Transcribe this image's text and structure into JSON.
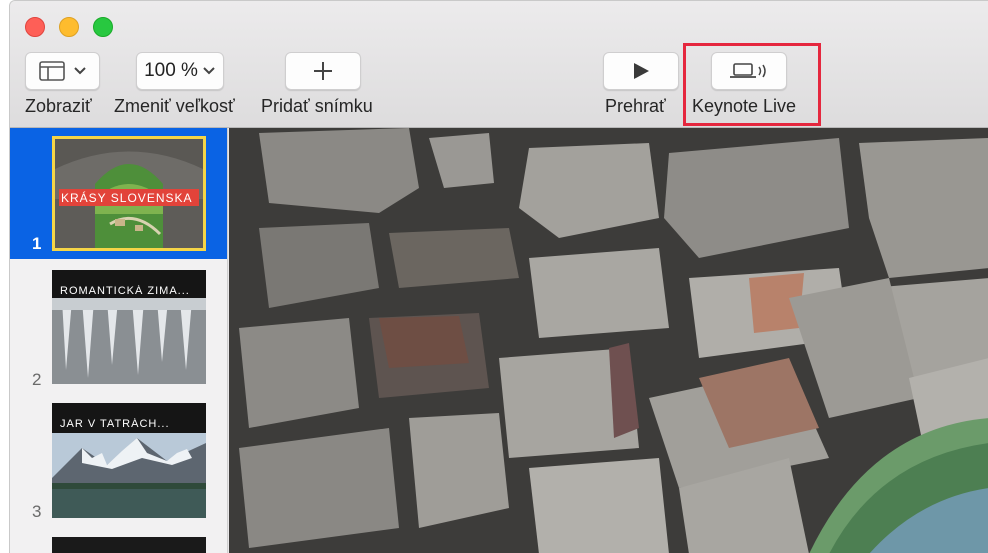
{
  "toolbar": {
    "view_label": "Zobraziť",
    "zoom_value": "100 %",
    "zoom_label": "Zmeniť veľkosť",
    "add_slide_label": "Pridať snímku",
    "play_label": "Prehrať",
    "keynote_live_label": "Keynote Live"
  },
  "slides": [
    {
      "number": "1",
      "title": "KRÁSY SLOVENSKA"
    },
    {
      "number": "2",
      "title": "ROMANTICKÁ ZIMA..."
    },
    {
      "number": "3",
      "title": "JAR V TATRÁCH..."
    }
  ],
  "colors": {
    "selection": "#0a63e4",
    "highlight_box": "#e5273e",
    "slide1_banner": "#e2433a"
  },
  "icons": {
    "view": "sidebar-layout-icon",
    "zoom": "chevron-down-icon",
    "add": "plus-icon",
    "play": "play-icon",
    "live": "laptop-broadcast-icon"
  }
}
